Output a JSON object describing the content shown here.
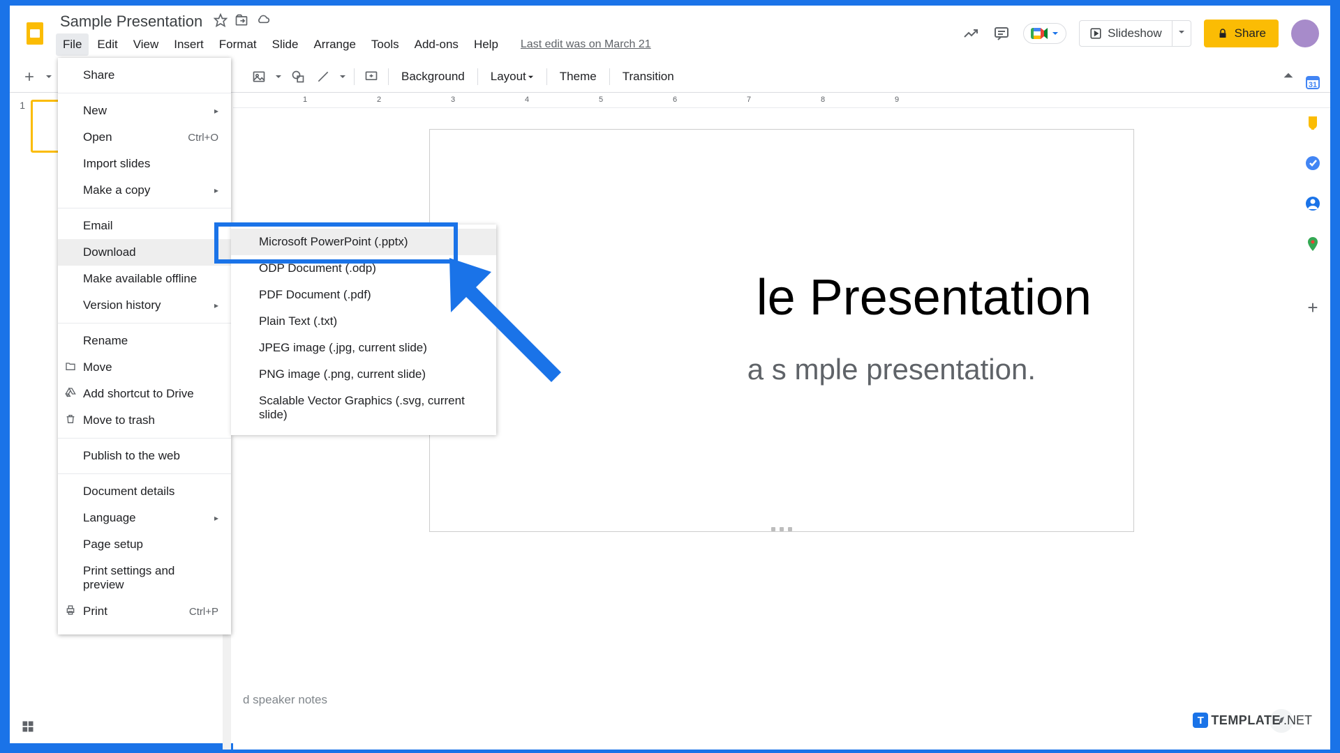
{
  "doc": {
    "title": "Sample Presentation",
    "last_edit": "Last edit was on March 21"
  },
  "menus": {
    "file": "File",
    "edit": "Edit",
    "view": "View",
    "insert": "Insert",
    "format": "Format",
    "slide": "Slide",
    "arrange": "Arrange",
    "tools": "Tools",
    "addons": "Add-ons",
    "help": "Help"
  },
  "header": {
    "slideshow": "Slideshow",
    "share": "Share"
  },
  "toolbar": {
    "background": "Background",
    "layout": "Layout",
    "theme": "Theme",
    "transition": "Transition"
  },
  "file_menu": {
    "share": "Share",
    "new": "New",
    "open": "Open",
    "open_shortcut": "Ctrl+O",
    "import_slides": "Import slides",
    "make_a_copy": "Make a copy",
    "email": "Email",
    "download": "Download",
    "make_available_offline": "Make available offline",
    "version_history": "Version history",
    "rename": "Rename",
    "move": "Move",
    "add_shortcut": "Add shortcut to Drive",
    "move_to_trash": "Move to trash",
    "publish_web": "Publish to the web",
    "document_details": "Document details",
    "language": "Language",
    "page_setup": "Page setup",
    "print_settings": "Print settings and preview",
    "print": "Print",
    "print_shortcut": "Ctrl+P"
  },
  "download_submenu": {
    "pptx": "Microsoft PowerPoint (.pptx)",
    "odp": "ODP Document (.odp)",
    "pdf": "PDF Document (.pdf)",
    "txt": "Plain Text (.txt)",
    "jpeg": "JPEG image (.jpg, current slide)",
    "png": "PNG image (.png, current slide)",
    "svg": "Scalable Vector Graphics (.svg, current slide)"
  },
  "slide": {
    "num": "1",
    "title_fragment": "le Presentation",
    "subtitle_fragment": "a s    mple presentation."
  },
  "notes": {
    "placeholder": "d speaker notes"
  },
  "ruler": {
    "marks": [
      "1",
      "2",
      "3",
      "4",
      "5",
      "6",
      "7",
      "8",
      "9"
    ]
  },
  "watermark": {
    "bold": "TEMPLATE",
    "light": ".NET"
  }
}
